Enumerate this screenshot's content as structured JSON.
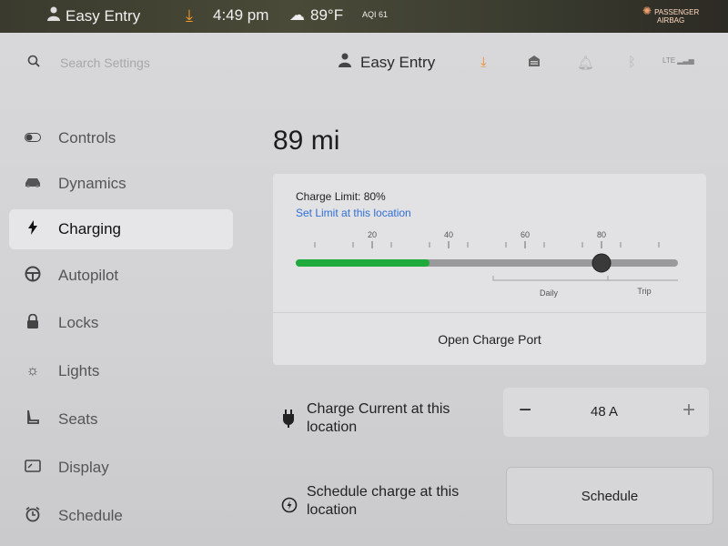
{
  "status_bar": {
    "profile": "Easy Entry",
    "time": "4:49 pm",
    "temperature": "89°F",
    "aqi": "AQI 61",
    "airbag_line1": "PASSENGER",
    "airbag_line2": "AIRBAG"
  },
  "header": {
    "search_placeholder": "Search Settings",
    "profile": "Easy Entry",
    "network": "LTE"
  },
  "sidebar": {
    "items": [
      {
        "label": "Controls",
        "icon": "toggle-icon"
      },
      {
        "label": "Dynamics",
        "icon": "car-icon"
      },
      {
        "label": "Charging",
        "icon": "lightning-icon",
        "active": true
      },
      {
        "label": "Autopilot",
        "icon": "steering-wheel-icon"
      },
      {
        "label": "Locks",
        "icon": "lock-icon"
      },
      {
        "label": "Lights",
        "icon": "light-icon"
      },
      {
        "label": "Seats",
        "icon": "seat-icon"
      },
      {
        "label": "Display",
        "icon": "display-icon"
      },
      {
        "label": "Schedule",
        "icon": "alarm-icon"
      }
    ]
  },
  "charging": {
    "range": "89 mi",
    "charge_limit": "Charge Limit: 80%",
    "set_limit_link": "Set Limit at this location",
    "slider_ticks": [
      "20",
      "40",
      "60",
      "80"
    ],
    "current_charge_percent": 35,
    "limit_percent": 80,
    "daily_label": "Daily",
    "trip_label": "Trip",
    "open_port": "Open Charge Port",
    "current_label": "Charge Current at this location",
    "current_value": "48 A",
    "minus": "−",
    "plus": "+",
    "schedule_label": "Schedule charge at this location",
    "schedule_button": "Schedule",
    "colors": {
      "charge_fill": "#1faa3e",
      "link": "#2f6fd6",
      "accent": "#f08c2a"
    }
  }
}
